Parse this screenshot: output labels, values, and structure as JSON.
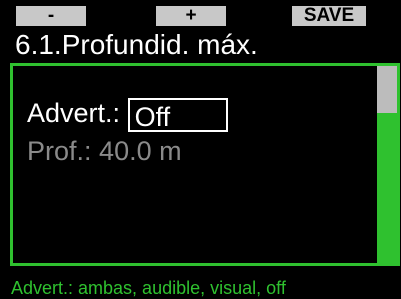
{
  "softkeys": {
    "minus": "-",
    "plus": "+",
    "save": "SAVE"
  },
  "screen": {
    "title": "6.1.Profundid. máx."
  },
  "settings": {
    "warning_label": "Advert.:",
    "warning_value": "Off",
    "depth_label": "Prof.:",
    "depth_value": "40.0 m"
  },
  "hint": {
    "text": "Advert.: ambas, audible, visual, off"
  },
  "colors": {
    "accent_green": "#2fc12f",
    "softkey_gray": "#c8c8c8",
    "disabled_text": "#8a8a8a",
    "background": "#000000"
  }
}
